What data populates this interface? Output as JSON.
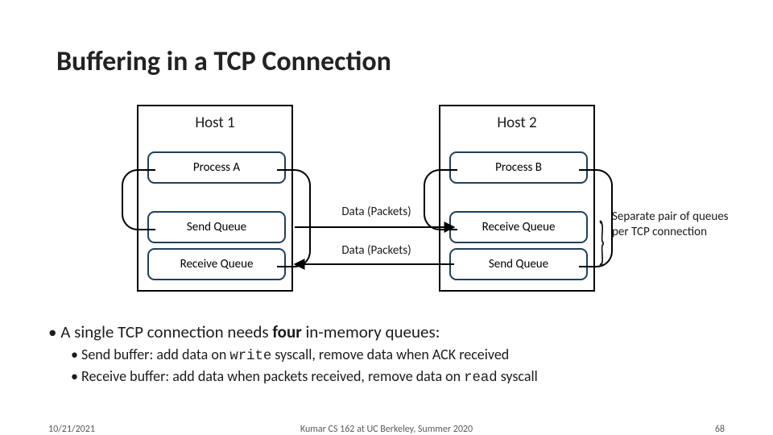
{
  "title": "Buffering in a TCP Connection",
  "hosts": {
    "h1": {
      "label": "Host 1",
      "process": "Process A",
      "q_top": "Send Queue",
      "q_bot": "Receive Queue"
    },
    "h2": {
      "label": "Host 2",
      "process": "Process B",
      "q_top": "Receive Queue",
      "q_bot": "Send Queue"
    }
  },
  "mid": {
    "top_label": "Data (Packets)",
    "bot_label": "Data (Packets)"
  },
  "annotation": "Separate pair of queues per TCP connection",
  "bullets": {
    "main": "A single TCP connection needs ",
    "main_bold": "four",
    "main_tail": " in-memory queues:",
    "sub1_a": "Send buffer: add data on ",
    "sub1_code": "write",
    "sub1_b": " syscall, remove data when ACK received",
    "sub2_a": "Receive buffer: add data when packets received, remove data on ",
    "sub2_code": "read",
    "sub2_b": " syscall"
  },
  "footer": {
    "date": "10/21/2021",
    "mid": "Kumar CS 162 at UC Berkeley, Summer 2020",
    "pagenum": "68"
  }
}
